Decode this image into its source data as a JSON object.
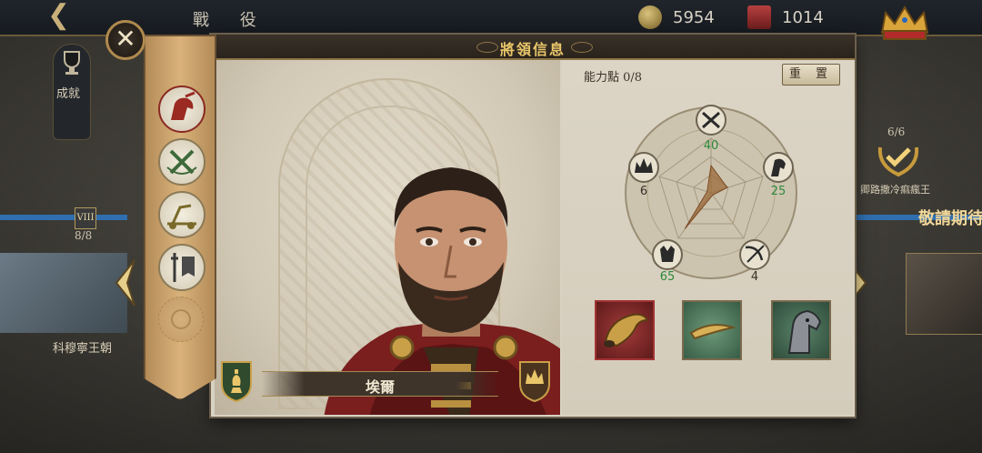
{
  "topbar": {
    "title": "戰 役",
    "gold": "5954",
    "honor": "1014"
  },
  "background": {
    "achievement_label": "成就",
    "level_badge": "VIII",
    "level_count": "8/8",
    "left_card_label": "科穆寧王朝",
    "right_badge_count": "6/6",
    "right_badge_label": "卿路撒冷痲瘋王",
    "coming_soon": "敬請期待"
  },
  "dialog": {
    "title": "將領信息",
    "general_name": "埃爾",
    "points_label": "能力點 0/8",
    "reset_label": "重 置",
    "close_icon": "close-icon"
  },
  "tabs": [
    {
      "name": "info-tab",
      "icon": "cavalry-icon",
      "active": true
    },
    {
      "name": "skills-tab",
      "icon": "crossed-swords-icon",
      "active": false
    },
    {
      "name": "siege-tab",
      "icon": "catapult-icon",
      "active": false
    },
    {
      "name": "equipment-tab",
      "icon": "sword-banner-icon",
      "active": false
    },
    {
      "name": "locked-tab",
      "icon": "locked-slot-icon",
      "active": false
    }
  ],
  "stats": [
    {
      "name": "attack",
      "icon": "swords-icon",
      "value": "40",
      "color": "#2e8a3a"
    },
    {
      "name": "cavalry",
      "icon": "horse-icon",
      "value": "25",
      "color": "#2e8a3a"
    },
    {
      "name": "archery",
      "icon": "bow-icon",
      "value": "4",
      "color": "#3a2f25"
    },
    {
      "name": "defense",
      "icon": "eagle-icon",
      "value": "65",
      "color": "#2e8a3a"
    },
    {
      "name": "command",
      "icon": "crown-icon",
      "value": "6",
      "color": "#3a2f25"
    }
  ],
  "equipment": [
    {
      "name": "war-horn",
      "icon": "horn-icon",
      "rarity_color": "#a23333"
    },
    {
      "name": "horn-tusk",
      "icon": "tusk-icon",
      "rarity_color": "#4a7a5a"
    },
    {
      "name": "armored-horse",
      "icon": "horse-head-icon",
      "rarity_color": "#3e6a50"
    }
  ]
}
